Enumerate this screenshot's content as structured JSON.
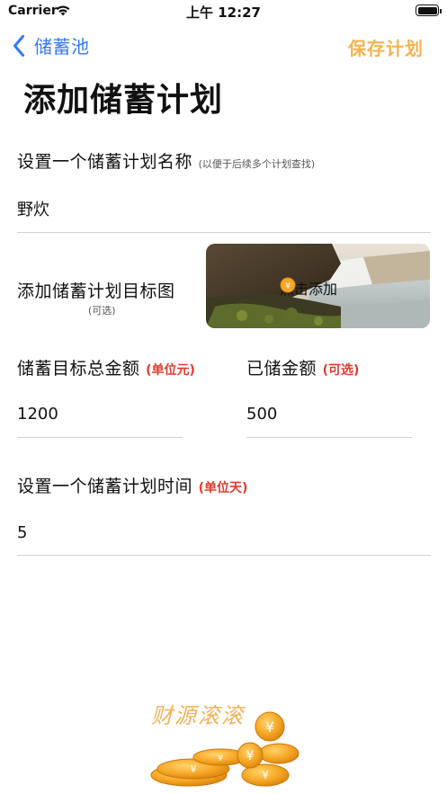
{
  "status": {
    "carrier": "Carrier",
    "time": "上午 12:27"
  },
  "nav": {
    "back_label": "储蓄池",
    "save_label": "保存计划"
  },
  "page_title": "添加储蓄计划",
  "plan_name": {
    "label": "设置一个储蓄计划名称",
    "hint": "(以便于后续多个计划查找)",
    "value": "野炊"
  },
  "target_image": {
    "label": "添加储蓄计划目标图",
    "optional": "(可选)",
    "button_label": "点击添加"
  },
  "target_amount": {
    "label": "储蓄目标总金额",
    "hint": "(单位元)",
    "value": "1200"
  },
  "saved_amount": {
    "label": "已储金额",
    "hint": "(可选)",
    "value": "500"
  },
  "plan_time": {
    "label": "设置一个储蓄计划时间",
    "hint": "(单位天)",
    "value": "5"
  },
  "footer": {
    "slogan": "财源滚滚"
  },
  "colors": {
    "accent_blue": "#3478f6",
    "save_orange": "#f5b34f",
    "hint_red": "#e23b2e",
    "coin_gold": "#f5a623"
  },
  "icons": {
    "back": "chevron-left-icon",
    "wifi": "wifi-icon",
    "battery": "battery-icon",
    "coin": "coin-icon"
  }
}
